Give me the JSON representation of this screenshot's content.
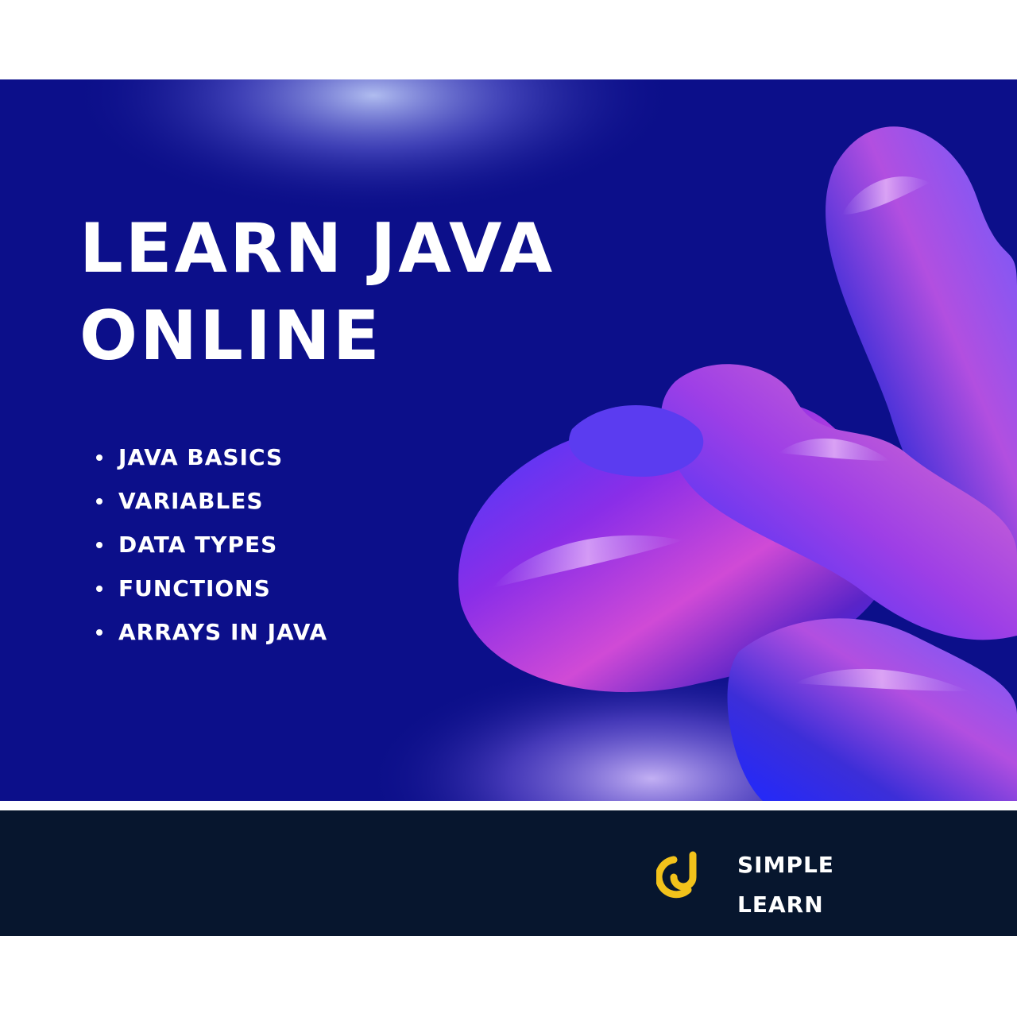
{
  "banner": {
    "headline_line1": "LEARN JAVA",
    "headline_line2": "ONLINE",
    "topics": [
      "JAVA BASICS",
      "VARIABLES",
      "DATA TYPES",
      "FUNCTIONS",
      "ARRAYS IN JAVA"
    ],
    "colors": {
      "background": "#0c0f8a",
      "text": "#ffffff"
    }
  },
  "footer": {
    "brand_line1": "SIMPLE",
    "brand_line2": "LEARN",
    "logo_icon": "simple-learn-logo-icon",
    "colors": {
      "background": "#07162e",
      "logo": "#f2c21b"
    }
  }
}
